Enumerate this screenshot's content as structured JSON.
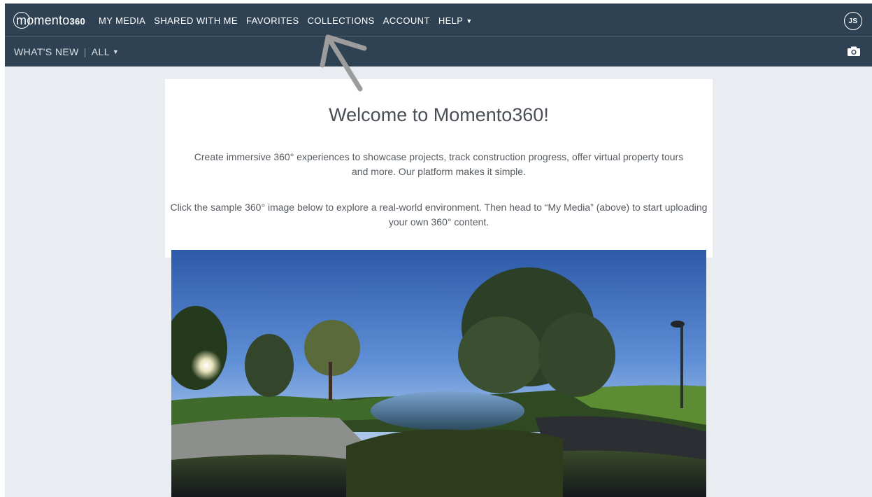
{
  "app": {
    "logo": {
      "text": "momento",
      "suffix": "360"
    },
    "nav": [
      {
        "label": "MY MEDIA"
      },
      {
        "label": "SHARED WITH ME"
      },
      {
        "label": "FAVORITES"
      },
      {
        "label": "COLLECTIONS"
      },
      {
        "label": "ACCOUNT"
      },
      {
        "label": "HELP",
        "icon": "caret-down-icon"
      }
    ],
    "user_initials": "JS"
  },
  "subbar": {
    "whats_new": "WHAT'S NEW",
    "separator": "|",
    "filter": "ALL",
    "filter_icon": "caret-down-icon",
    "camera_icon": "camera-icon"
  },
  "welcome": {
    "title": "Welcome to Momento360!",
    "paragraph1": "Create immersive 360° experiences to showcase projects, track construction progress, offer virtual property tours and more. Our platform makes it simple.",
    "paragraph2": "Click the sample 360° image below to explore a real-world environment. Then head to “My Media” (above) to start uploading your own 360° content."
  },
  "colors": {
    "navbar": "#2f4253",
    "page_bg": "#e9ecf1",
    "card_bg": "#ffffff",
    "text": "#4a4f55"
  }
}
